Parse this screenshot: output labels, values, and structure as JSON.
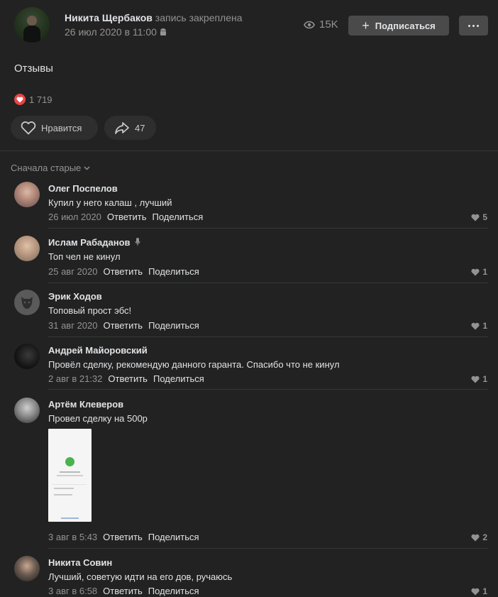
{
  "post": {
    "author": "Никита Щербаков",
    "pinned_note": "запись закреплена",
    "date": "26 июл 2020 в 11:00",
    "views": "15K",
    "subscribe_label": "Подписаться",
    "text": "Отзывы",
    "likes_count": "1 719",
    "like_label": "Нравится",
    "shares_count": "47"
  },
  "comments_section": {
    "sort_label": "Сначала старые"
  },
  "comments": [
    {
      "name": "Олег Поспелов",
      "text": "Купил у него калаш , лучший",
      "date": "26 июл 2020",
      "reply": "Ответить",
      "share": "Поделиться",
      "likes": "5"
    },
    {
      "name": "Ислам Рабаданов",
      "text": "Топ чел не кинул",
      "date": "25 авг 2020",
      "reply": "Ответить",
      "share": "Поделиться",
      "likes": "1"
    },
    {
      "name": "Эрик Ходов",
      "text": "Топовый прост эбс!",
      "date": "31 авг 2020",
      "reply": "Ответить",
      "share": "Поделиться",
      "likes": "1"
    },
    {
      "name": "Андрей Майоровский",
      "text": "Провёл сделку, рекомендую данного гаранта. Спасибо что не кинул",
      "date": "2 авг в 21:32",
      "reply": "Ответить",
      "share": "Поделиться",
      "likes": "1"
    },
    {
      "name": "Артём Клеверов",
      "text": "Провел сделку на 500р",
      "date": "3 авг в 5:43",
      "reply": "Ответить",
      "share": "Поделиться",
      "likes": "2"
    },
    {
      "name": "Никита Совин",
      "text": "Лучший, советую идти на его дов, ручаюсь",
      "date": "3 авг в 6:58",
      "reply": "Ответить",
      "share": "Поделиться",
      "likes": "1"
    }
  ],
  "colors": {
    "background": "#222222",
    "text_primary": "#e1e3e6",
    "text_secondary": "#939393",
    "like_red": "#e64646",
    "button_bg": "#4a4a4a"
  }
}
